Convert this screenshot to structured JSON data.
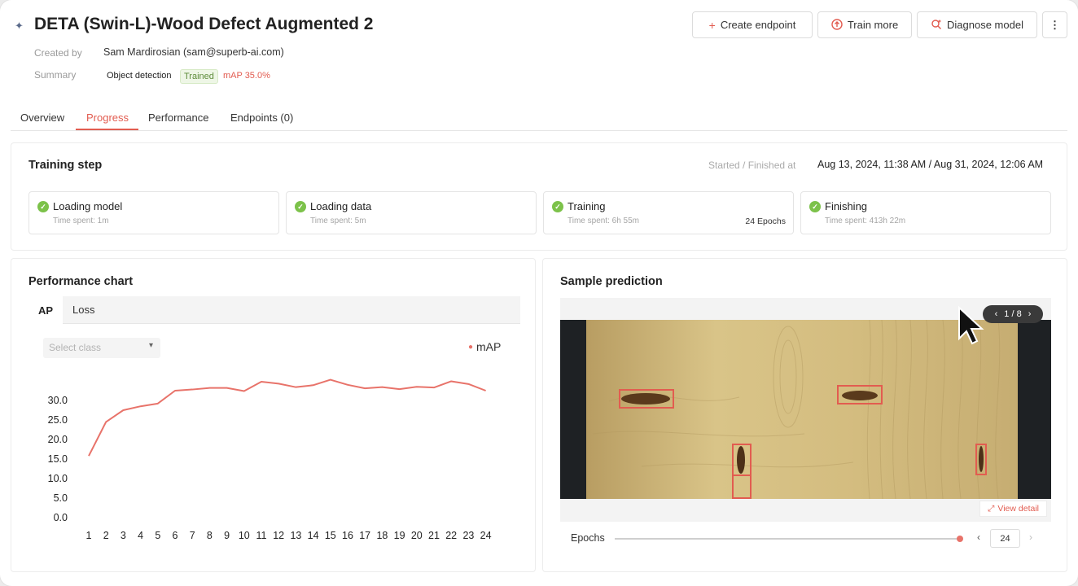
{
  "header": {
    "title": "DETA (Swin-L)-Wood Defect Augmented 2",
    "created_by_label": "Created by",
    "created_by_value": "Sam Mardirosian (sam@superb-ai.com)",
    "summary_label": "Summary",
    "summary_type": "Object detection",
    "summary_status": "Trained",
    "summary_map": "mAP 35.0%",
    "model_icon": "model-icon"
  },
  "actions": {
    "create_endpoint": "Create endpoint",
    "train_more": "Train more",
    "diagnose_model": "Diagnose model",
    "more": "⋮"
  },
  "tabs": [
    {
      "label": "Overview"
    },
    {
      "label": "Progress"
    },
    {
      "label": "Performance"
    },
    {
      "label": "Endpoints (0)"
    }
  ],
  "training_step": {
    "title": "Training step",
    "started_label": "Started / Finished at",
    "started_value": "Aug 13, 2024, 11:38 AM / Aug 31, 2024, 12:06 AM",
    "steps": [
      {
        "label": "Loading model",
        "time": "Time spent: 1m",
        "extra": ""
      },
      {
        "label": "Loading data",
        "time": "Time spent: 5m",
        "extra": ""
      },
      {
        "label": "Training",
        "time": "Time spent: 6h 55m",
        "extra": "24 Epochs"
      },
      {
        "label": "Finishing",
        "time": "Time spent: 413h 22m",
        "extra": ""
      }
    ]
  },
  "performance_chart": {
    "title": "Performance chart",
    "tab_ap": "AP",
    "tab_loss": "Loss",
    "select_placeholder": "Select class",
    "legend": "mAP"
  },
  "chart_data": {
    "type": "line",
    "x": [
      1,
      2,
      3,
      4,
      5,
      6,
      7,
      8,
      9,
      10,
      11,
      12,
      13,
      14,
      15,
      16,
      17,
      18,
      19,
      20,
      21,
      22,
      23,
      24
    ],
    "series": [
      {
        "name": "mAP",
        "values": [
          15.8,
          24.5,
          27.5,
          28.5,
          29.2,
          32.5,
          32.8,
          33.2,
          33.2,
          32.4,
          34.8,
          34.3,
          33.4,
          33.9,
          35.3,
          34.0,
          33.1,
          33.4,
          32.9,
          33.5,
          33.3,
          34.9,
          34.2,
          32.5
        ]
      }
    ],
    "yticks": [
      "0.0",
      "5.0",
      "10.0",
      "15.0",
      "20.0",
      "25.0",
      "30.0"
    ],
    "ylim": [
      0,
      30
    ],
    "color": "#e8736a",
    "grid": false,
    "legend_position": "top-right"
  },
  "sample_prediction": {
    "title": "Sample prediction",
    "pager": "1 / 8",
    "view_detail": "View detail",
    "epochs_label": "Epochs",
    "epoch_value": "24",
    "slider_fraction": 1.0,
    "box_color": "#e25c50"
  }
}
